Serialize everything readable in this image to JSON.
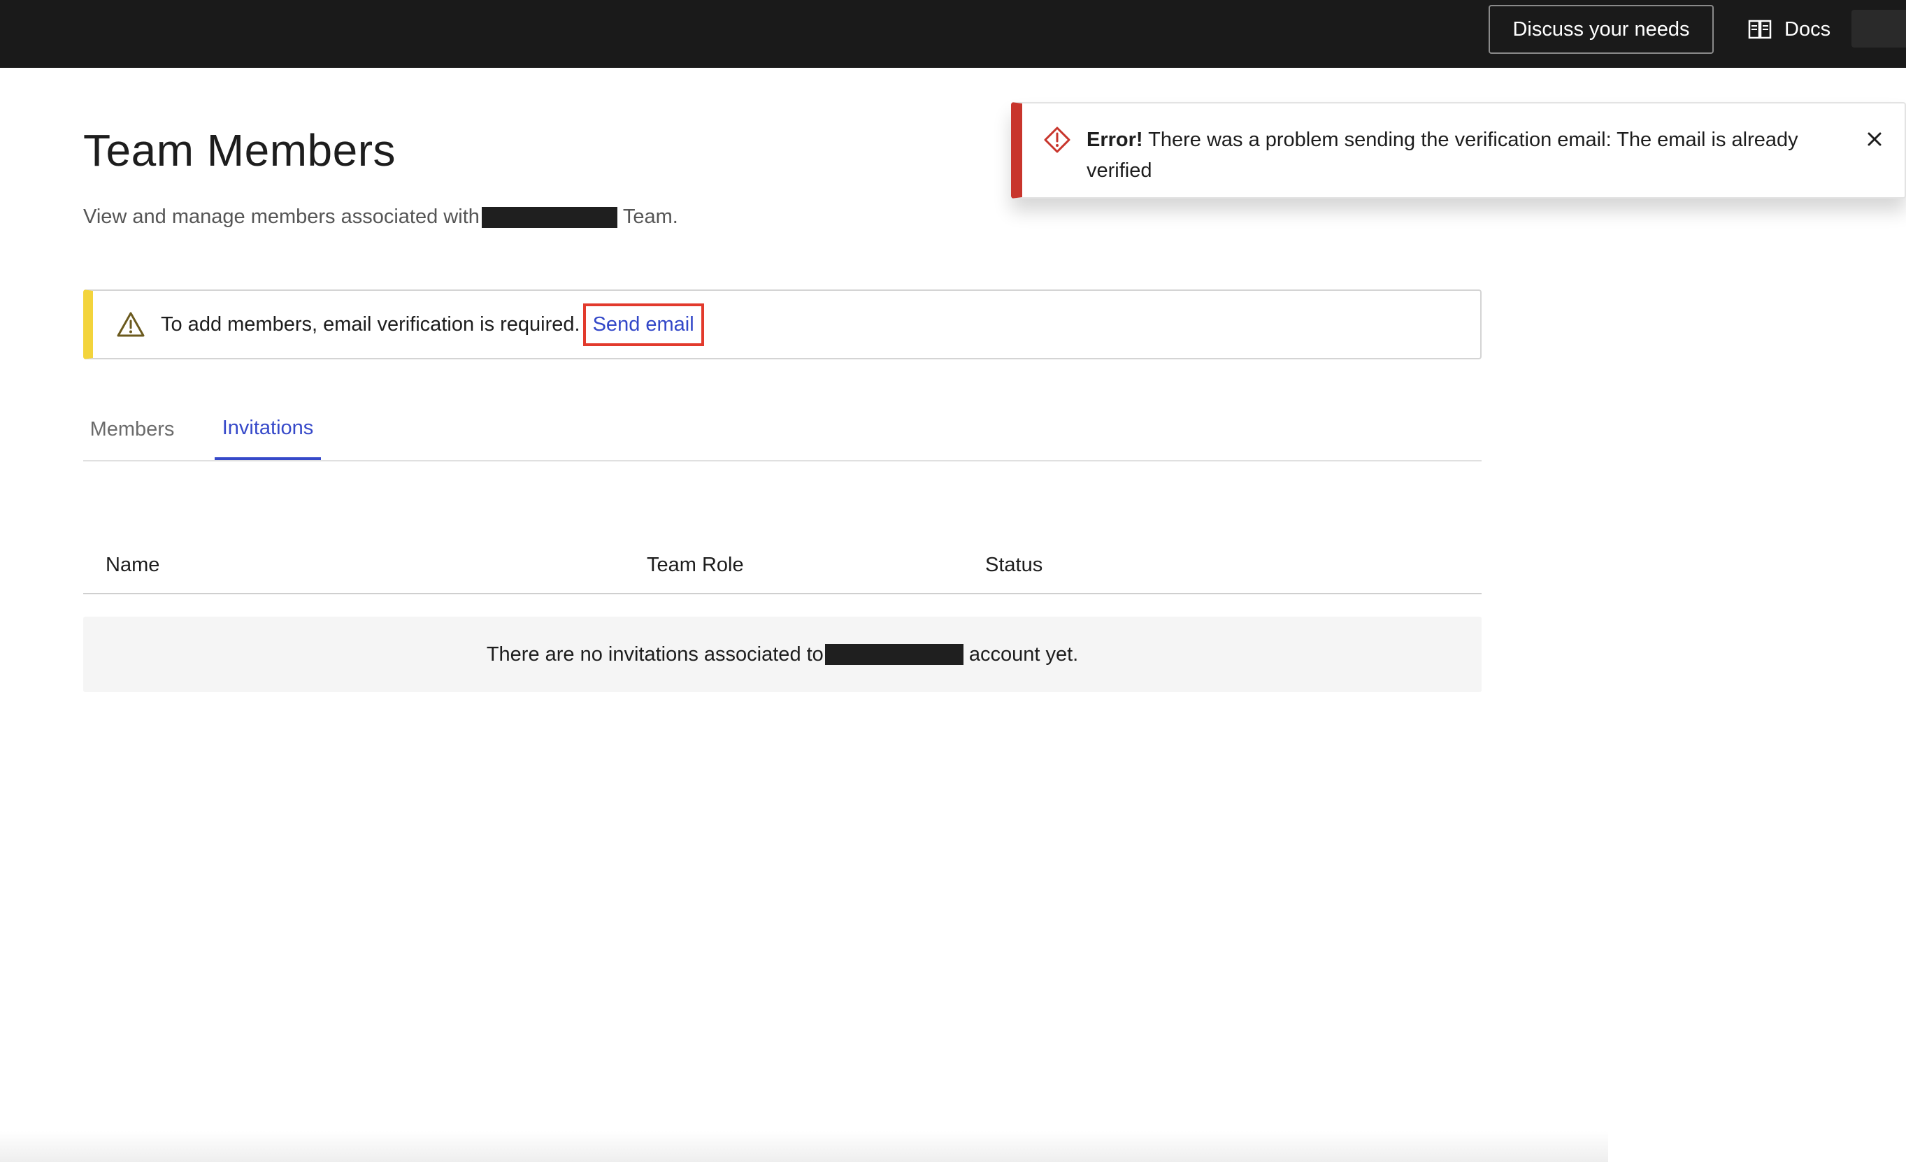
{
  "header": {
    "discuss_label": "Discuss your needs",
    "docs_label": "Docs",
    "docs_icon": "book-icon"
  },
  "page": {
    "title": "Team Members",
    "subtitle_prefix": "View and manage members associated with",
    "subtitle_suffix": "Team."
  },
  "verification_banner": {
    "icon": "warning-triangle-icon",
    "message": "To add members, email verification is required.",
    "action_label": "Send email",
    "accent_color": "#f3d43c"
  },
  "tabs": [
    {
      "label": "Members",
      "active": false
    },
    {
      "label": "Invitations",
      "active": true
    }
  ],
  "table": {
    "columns": [
      "Name",
      "Team Role",
      "Status"
    ],
    "empty_prefix": "There are no invitations associated to",
    "empty_suffix": "account yet."
  },
  "toast": {
    "icon": "error-diamond-icon",
    "title": "Error!",
    "message": "There was a problem sending the verification email: The email is already verified",
    "close_icon": "close-icon",
    "accent_color": "#c8352c"
  },
  "colors": {
    "topbar": "#1a1a1a",
    "link": "#3649c9"
  }
}
